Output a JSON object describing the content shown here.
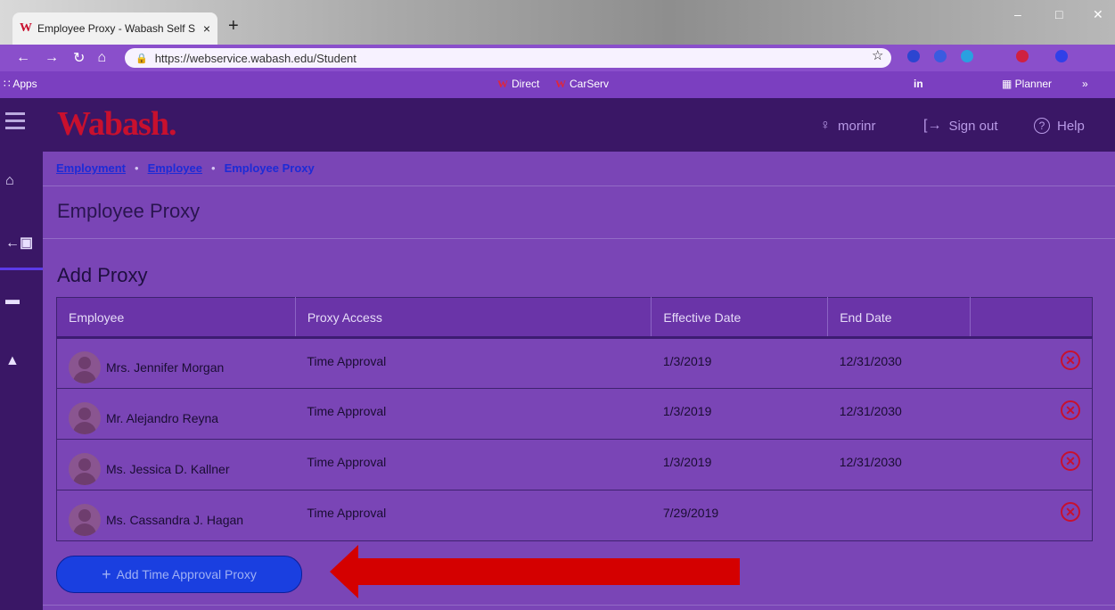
{
  "browser": {
    "tab_title": "Employee Proxy - Wabash Self S",
    "tab_favicon": "W",
    "close_glyph": "×",
    "new_tab_glyph": "+",
    "address": "https://webservice.wabash.edu/Student",
    "bookmarks": [
      {
        "label": "Apps"
      },
      {
        "label": "Direct"
      },
      {
        "label": "CarServ"
      },
      {
        "label": "Planner"
      }
    ],
    "overflow": "»"
  },
  "header": {
    "logo": "Wabash.",
    "user": "morinr",
    "sign_out": "Sign out",
    "help": "Help"
  },
  "breadcrumb": {
    "items": [
      "Employment",
      "Employee"
    ],
    "current": "Employee Proxy",
    "separator": "•"
  },
  "page_title": "Employee Proxy",
  "section_title": "Add Proxy",
  "table": {
    "columns": [
      "Employee",
      "Proxy Access",
      "Effective Date",
      "End Date",
      ""
    ],
    "rows": [
      {
        "employee": "Mrs. Jennifer Morgan",
        "access": "Time Approval",
        "effective": "1/3/2019",
        "end": "12/31/2030"
      },
      {
        "employee": "Mr. Alejandro Reyna",
        "access": "Time Approval",
        "effective": "1/3/2019",
        "end": "12/31/2030"
      },
      {
        "employee": "Ms. Jessica D. Kallner",
        "access": "Time Approval",
        "effective": "1/3/2019",
        "end": "12/31/2030"
      },
      {
        "employee": "Ms. Cassandra J. Hagan",
        "access": "Time Approval",
        "effective": "7/29/2019",
        "end": ""
      }
    ],
    "remove_glyph": "✕"
  },
  "add_button": {
    "plus": "+",
    "label": "Add Time Approval Proxy"
  },
  "icons": {
    "hamburger": "menu-icon",
    "home": "home-icon",
    "rail_2": "exit-icon",
    "rail_3": "briefcase-icon",
    "rail_4": "person-icon",
    "user": "user-icon",
    "signout": "sign-out-icon",
    "help": "help-icon",
    "remove": "remove-icon"
  },
  "colors": {
    "accent_red": "#c8102e",
    "link_blue": "#1d2bd6",
    "button_blue": "#1a3fe0",
    "annotation_arrow": "#d40000"
  }
}
